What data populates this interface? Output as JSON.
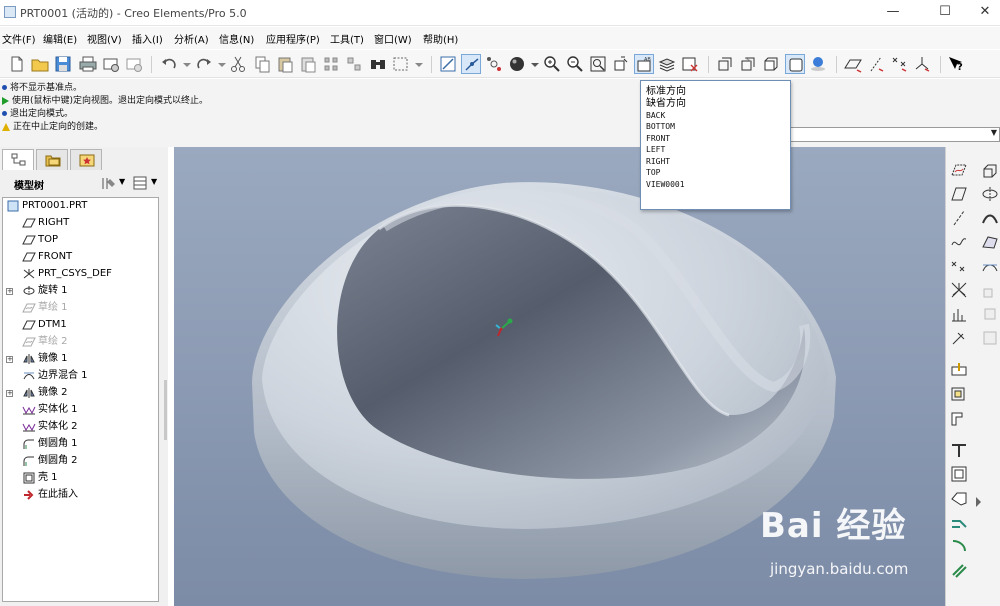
{
  "window": {
    "title": "PRT0001 (活动的) - Creo Elements/Pro 5.0",
    "minimize": "—",
    "maximize": "☐",
    "close": "✕"
  },
  "menubar": {
    "items": [
      "文件(F)",
      "编辑(E)",
      "视图(V)",
      "插入(I)",
      "分析(A)",
      "信息(N)",
      "应用程序(P)",
      "工具(T)",
      "窗口(W)",
      "帮助(H)"
    ]
  },
  "messages": [
    {
      "text": "将不显示基准点。",
      "icon": "info-dot-icon"
    },
    {
      "text": "使用(鼠标中键)定向视图。退出定向模式以终止。",
      "icon": "green-arrow-icon"
    },
    {
      "text": "退出定向模式。",
      "icon": "info-dot-icon"
    },
    {
      "text": "正在中止定向的创建。",
      "icon": "warning-icon"
    }
  ],
  "model_tree": {
    "header": "模型树",
    "items": [
      {
        "label": "PRT0001.PRT",
        "icon": "part-icon",
        "expandable": false,
        "dim": false
      },
      {
        "label": "RIGHT",
        "icon": "datum-plane-icon",
        "expandable": false,
        "dim": false
      },
      {
        "label": "TOP",
        "icon": "datum-plane-icon",
        "expandable": false,
        "dim": false
      },
      {
        "label": "FRONT",
        "icon": "datum-plane-icon",
        "expandable": false,
        "dim": false
      },
      {
        "label": "PRT_CSYS_DEF",
        "icon": "csys-icon",
        "expandable": false,
        "dim": false
      },
      {
        "label": "旋转 1",
        "icon": "revolve-icon",
        "expandable": true,
        "dim": false
      },
      {
        "label": "草绘 1",
        "icon": "sketch-icon",
        "expandable": false,
        "dim": true
      },
      {
        "label": "DTM1",
        "icon": "datum-plane-icon",
        "expandable": false,
        "dim": false
      },
      {
        "label": "草绘 2",
        "icon": "sketch-icon",
        "expandable": false,
        "dim": true
      },
      {
        "label": "镜像 1",
        "icon": "mirror-icon",
        "expandable": true,
        "dim": false
      },
      {
        "label": "边界混合 1",
        "icon": "boundary-blend-icon",
        "expandable": false,
        "dim": false
      },
      {
        "label": "镜像 2",
        "icon": "mirror-icon",
        "expandable": true,
        "dim": false
      },
      {
        "label": "实体化 1",
        "icon": "solidify-icon",
        "expandable": false,
        "dim": false
      },
      {
        "label": "实体化 2",
        "icon": "solidify-icon",
        "expandable": false,
        "dim": false
      },
      {
        "label": "倒圆角 1",
        "icon": "round-icon",
        "expandable": false,
        "dim": false
      },
      {
        "label": "倒圆角 2",
        "icon": "round-icon",
        "expandable": false,
        "dim": false
      },
      {
        "label": "壳 1",
        "icon": "shell-icon",
        "expandable": false,
        "dim": false
      },
      {
        "label": "在此插入",
        "icon": "insert-here-icon",
        "expandable": false,
        "dim": false
      }
    ]
  },
  "view_dropdown": {
    "items": [
      "标准方向",
      "缺省方向",
      "BACK",
      "BOTTOM",
      "FRONT",
      "LEFT",
      "RIGHT",
      "TOP",
      "VIEW0001"
    ]
  },
  "watermark": {
    "logo": "Bai 经验",
    "url": "jingyan.baidu.com"
  },
  "colors": {
    "accent": "#3b7dd8",
    "viewport_top": "#9aa9bf",
    "viewport_bottom": "#7c8ba6",
    "model": "#c9d0da"
  }
}
